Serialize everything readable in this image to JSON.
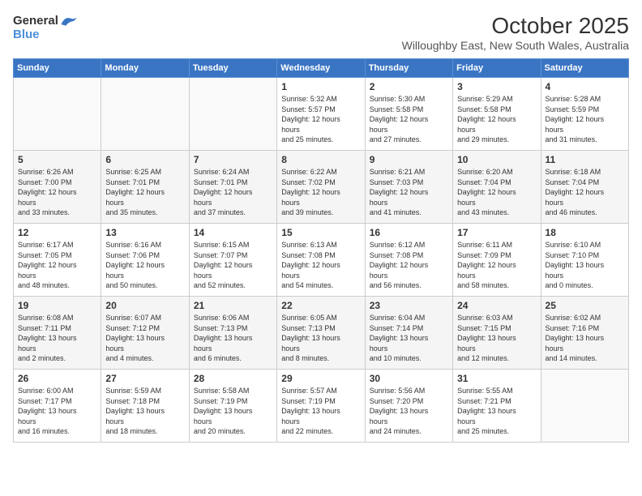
{
  "logo": {
    "general": "General",
    "blue": "Blue"
  },
  "title": "October 2025",
  "location": "Willoughby East, New South Wales, Australia",
  "headers": [
    "Sunday",
    "Monday",
    "Tuesday",
    "Wednesday",
    "Thursday",
    "Friday",
    "Saturday"
  ],
  "weeks": [
    {
      "cells": [
        {
          "day": "",
          "empty": true
        },
        {
          "day": "",
          "empty": true
        },
        {
          "day": "",
          "empty": true
        },
        {
          "day": "1",
          "sunrise": "5:32 AM",
          "sunset": "5:57 PM",
          "daylight": "12 hours and 25 minutes."
        },
        {
          "day": "2",
          "sunrise": "5:30 AM",
          "sunset": "5:58 PM",
          "daylight": "12 hours and 27 minutes."
        },
        {
          "day": "3",
          "sunrise": "5:29 AM",
          "sunset": "5:58 PM",
          "daylight": "12 hours and 29 minutes."
        },
        {
          "day": "4",
          "sunrise": "5:28 AM",
          "sunset": "5:59 PM",
          "daylight": "12 hours and 31 minutes."
        }
      ]
    },
    {
      "cells": [
        {
          "day": "5",
          "sunrise": "6:26 AM",
          "sunset": "7:00 PM",
          "daylight": "12 hours and 33 minutes."
        },
        {
          "day": "6",
          "sunrise": "6:25 AM",
          "sunset": "7:01 PM",
          "daylight": "12 hours and 35 minutes."
        },
        {
          "day": "7",
          "sunrise": "6:24 AM",
          "sunset": "7:01 PM",
          "daylight": "12 hours and 37 minutes."
        },
        {
          "day": "8",
          "sunrise": "6:22 AM",
          "sunset": "7:02 PM",
          "daylight": "12 hours and 39 minutes."
        },
        {
          "day": "9",
          "sunrise": "6:21 AM",
          "sunset": "7:03 PM",
          "daylight": "12 hours and 41 minutes."
        },
        {
          "day": "10",
          "sunrise": "6:20 AM",
          "sunset": "7:04 PM",
          "daylight": "12 hours and 43 minutes."
        },
        {
          "day": "11",
          "sunrise": "6:18 AM",
          "sunset": "7:04 PM",
          "daylight": "12 hours and 46 minutes."
        }
      ]
    },
    {
      "cells": [
        {
          "day": "12",
          "sunrise": "6:17 AM",
          "sunset": "7:05 PM",
          "daylight": "12 hours and 48 minutes."
        },
        {
          "day": "13",
          "sunrise": "6:16 AM",
          "sunset": "7:06 PM",
          "daylight": "12 hours and 50 minutes."
        },
        {
          "day": "14",
          "sunrise": "6:15 AM",
          "sunset": "7:07 PM",
          "daylight": "12 hours and 52 minutes."
        },
        {
          "day": "15",
          "sunrise": "6:13 AM",
          "sunset": "7:08 PM",
          "daylight": "12 hours and 54 minutes."
        },
        {
          "day": "16",
          "sunrise": "6:12 AM",
          "sunset": "7:08 PM",
          "daylight": "12 hours and 56 minutes."
        },
        {
          "day": "17",
          "sunrise": "6:11 AM",
          "sunset": "7:09 PM",
          "daylight": "12 hours and 58 minutes."
        },
        {
          "day": "18",
          "sunrise": "6:10 AM",
          "sunset": "7:10 PM",
          "daylight": "13 hours and 0 minutes."
        }
      ]
    },
    {
      "cells": [
        {
          "day": "19",
          "sunrise": "6:08 AM",
          "sunset": "7:11 PM",
          "daylight": "13 hours and 2 minutes."
        },
        {
          "day": "20",
          "sunrise": "6:07 AM",
          "sunset": "7:12 PM",
          "daylight": "13 hours and 4 minutes."
        },
        {
          "day": "21",
          "sunrise": "6:06 AM",
          "sunset": "7:13 PM",
          "daylight": "13 hours and 6 minutes."
        },
        {
          "day": "22",
          "sunrise": "6:05 AM",
          "sunset": "7:13 PM",
          "daylight": "13 hours and 8 minutes."
        },
        {
          "day": "23",
          "sunrise": "6:04 AM",
          "sunset": "7:14 PM",
          "daylight": "13 hours and 10 minutes."
        },
        {
          "day": "24",
          "sunrise": "6:03 AM",
          "sunset": "7:15 PM",
          "daylight": "13 hours and 12 minutes."
        },
        {
          "day": "25",
          "sunrise": "6:02 AM",
          "sunset": "7:16 PM",
          "daylight": "13 hours and 14 minutes."
        }
      ]
    },
    {
      "cells": [
        {
          "day": "26",
          "sunrise": "6:00 AM",
          "sunset": "7:17 PM",
          "daylight": "13 hours and 16 minutes."
        },
        {
          "day": "27",
          "sunrise": "5:59 AM",
          "sunset": "7:18 PM",
          "daylight": "13 hours and 18 minutes."
        },
        {
          "day": "28",
          "sunrise": "5:58 AM",
          "sunset": "7:19 PM",
          "daylight": "13 hours and 20 minutes."
        },
        {
          "day": "29",
          "sunrise": "5:57 AM",
          "sunset": "7:19 PM",
          "daylight": "13 hours and 22 minutes."
        },
        {
          "day": "30",
          "sunrise": "5:56 AM",
          "sunset": "7:20 PM",
          "daylight": "13 hours and 24 minutes."
        },
        {
          "day": "31",
          "sunrise": "5:55 AM",
          "sunset": "7:21 PM",
          "daylight": "13 hours and 25 minutes."
        },
        {
          "day": "",
          "empty": true
        }
      ]
    }
  ]
}
